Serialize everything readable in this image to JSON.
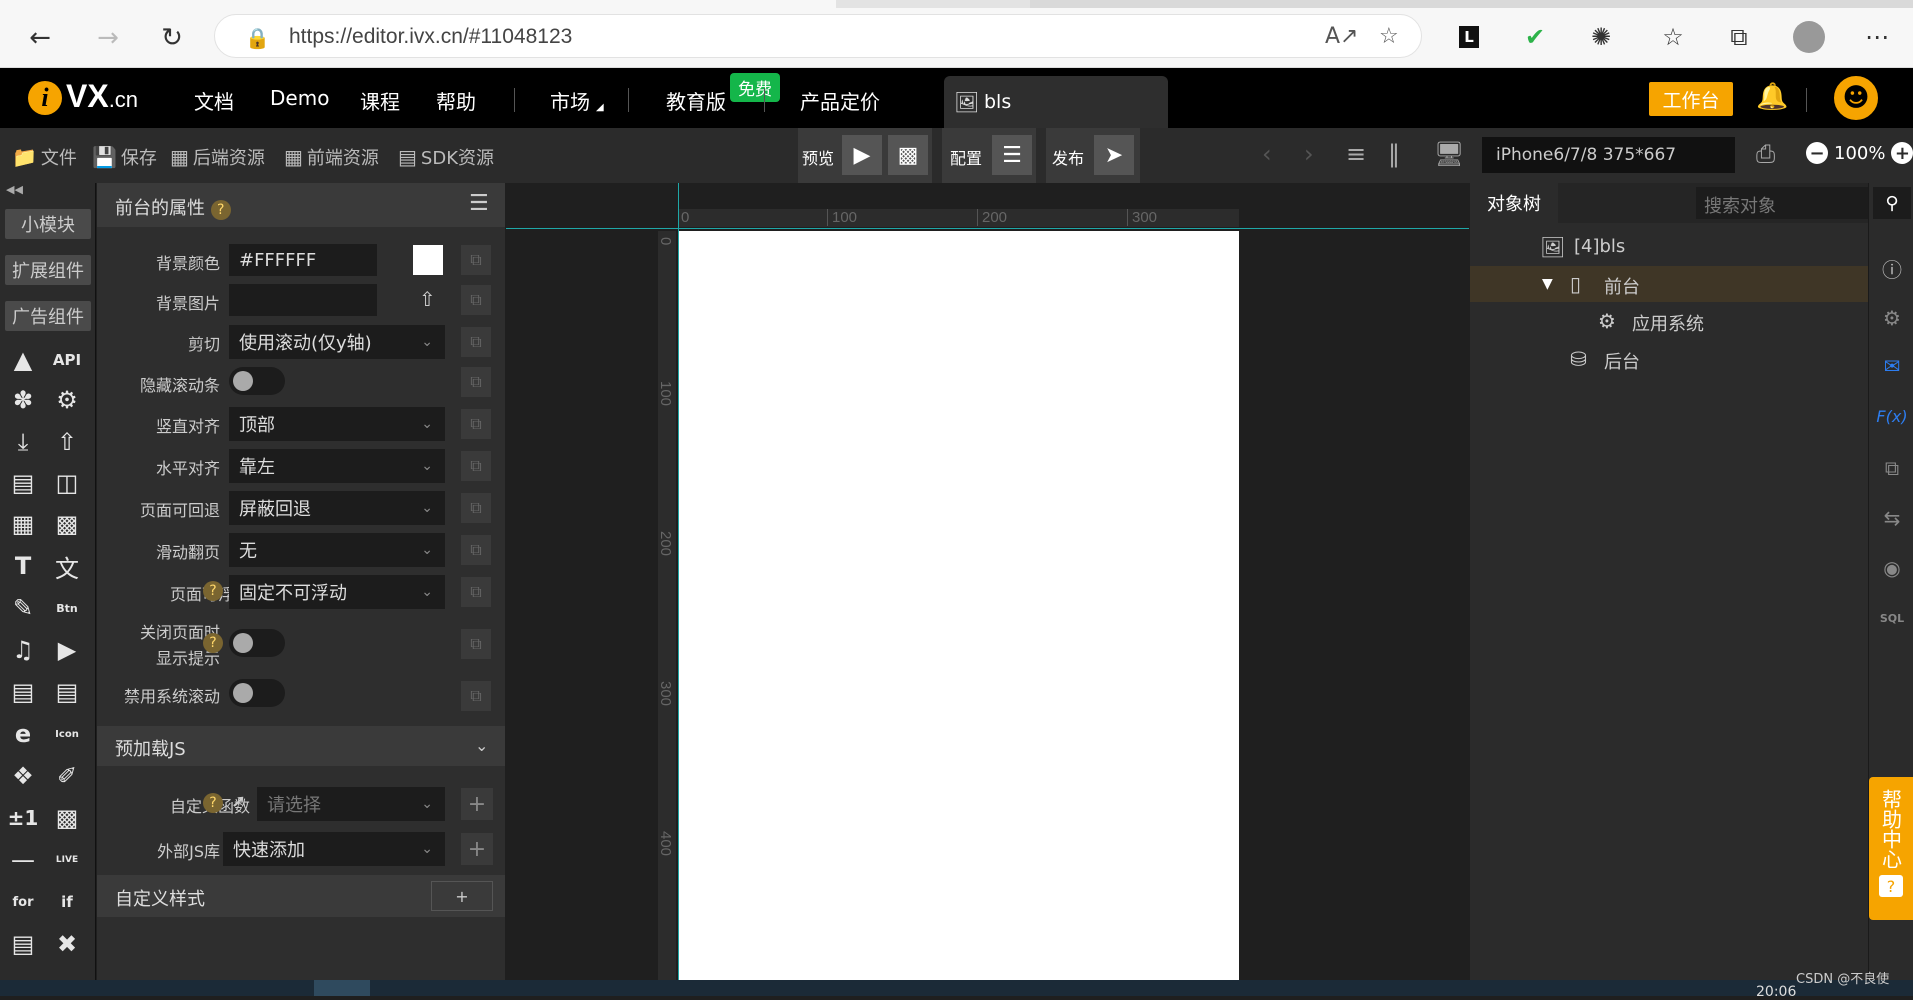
{
  "browser": {
    "url": "https://editor.ivx.cn/#11048123"
  },
  "appbar": {
    "logo_letter": "i",
    "logo_text": "VX",
    "logo_suffix": ".cn",
    "nav": [
      "文档",
      "Demo",
      "课程",
      "帮助",
      "市场",
      "教育版",
      "产品定价"
    ],
    "free_badge": "免费",
    "project_tab": "bls",
    "workbench": "工作台"
  },
  "toolbar": {
    "file": "文件",
    "save": "保存",
    "backend": "后端资源",
    "frontend": "前端资源",
    "sdk": "SDK资源",
    "preview": "预览",
    "config": "配置",
    "publish": "发布",
    "device": "iPhone6/7/8 375*667",
    "zoom": "100%"
  },
  "sidebar": {
    "buttons": [
      "小模块",
      "扩展组件",
      "广告组件"
    ],
    "api_label": "API",
    "btn_label": "Btn",
    "icon_label": "Icon",
    "live_label": "LIVE",
    "for_label": "for",
    "if_label": "if",
    "pm_label": "±1"
  },
  "props": {
    "title": "前台的属性",
    "rows": {
      "bg_color": {
        "label": "背景颜色",
        "value": "#FFFFFF"
      },
      "bg_image": {
        "label": "背景图片",
        "value": ""
      },
      "clip": {
        "label": "剪切",
        "value": "使用滚动(仅y轴)"
      },
      "hide_scrollbar": {
        "label": "隐藏滚动条"
      },
      "v_align": {
        "label": "竖直对齐",
        "value": "顶部"
      },
      "h_align": {
        "label": "水平对齐",
        "value": "靠左"
      },
      "back": {
        "label": "页面可回退",
        "value": "屏蔽回退"
      },
      "slide": {
        "label": "滑动翻页",
        "value": "无"
      },
      "float": {
        "label": "页面可浮动",
        "value": "固定不可浮动"
      },
      "close_tip": {
        "label1": "关闭页面时",
        "label2": "显示提示"
      },
      "disable_scroll": {
        "label": "禁用系统滚动"
      }
    },
    "preload_title": "预加载JS",
    "custom_func": {
      "label": "自定义函数",
      "placeholder": "请选择"
    },
    "ext_js": {
      "label": "外部JS库",
      "value": "快速添加"
    },
    "custom_style_title": "自定义样式",
    "add_symbol": "+"
  },
  "canvas": {
    "h_ticks": [
      "0",
      "100",
      "200",
      "300"
    ],
    "v_ticks": [
      "0",
      "100",
      "200",
      "300",
      "400"
    ]
  },
  "tree": {
    "tab": "对象树",
    "search_placeholder": "搜索对象",
    "items": [
      {
        "label": "[4]bls"
      },
      {
        "label": "前台"
      },
      {
        "label": "应用系统"
      },
      {
        "label": "后台"
      }
    ]
  },
  "rightstrip": {
    "fx": "F(x)",
    "sql": "SQL"
  },
  "helpcenter": {
    "label": "帮助中心",
    "q": "?"
  },
  "footer": {
    "watermark": "CSDN @不良使",
    "clock": "20:06"
  }
}
